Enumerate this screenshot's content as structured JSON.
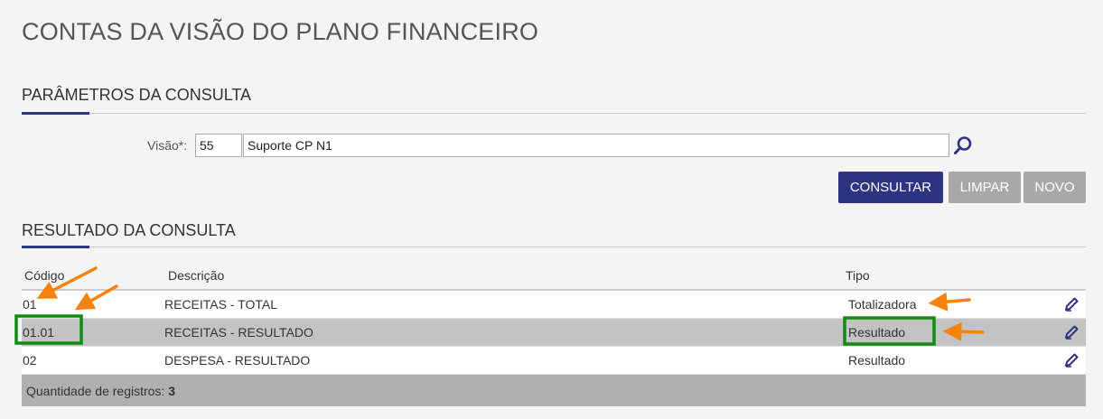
{
  "page": {
    "title": "CONTAS DA VISÃO DO PLANO FINANCEIRO"
  },
  "params": {
    "section_title": "PARÂMETROS DA CONSULTA",
    "visao_label": "Visão*:",
    "visao_code": "55",
    "visao_name": "Suporte CP N1",
    "search_icon": "magnifier-icon"
  },
  "buttons": {
    "consultar": "CONSULTAR",
    "limpar": "LIMPAR",
    "novo": "NOVO"
  },
  "results": {
    "section_title": "RESULTADO DA CONSULTA",
    "columns": {
      "codigo": "Código",
      "descricao": "Descrição",
      "tipo": "Tipo"
    },
    "rows": [
      {
        "codigo": "01",
        "descricao": "RECEITAS - TOTAL",
        "tipo": "Totalizadora",
        "selected": false
      },
      {
        "codigo": "01.01",
        "descricao": "RECEITAS - RESULTADO",
        "tipo": "Resultado",
        "selected": true
      },
      {
        "codigo": "02",
        "descricao": "DESPESA - RESULTADO",
        "tipo": "Resultado",
        "selected": false
      }
    ],
    "footer_label": "Quantidade de registros:",
    "footer_count": "3"
  },
  "colors": {
    "accent": "#2d3482",
    "disabled": "#a8a8a8",
    "selected_row": "#c3c3c3",
    "annotation_arrow": "#f5820d",
    "annotation_box": "#138a13"
  }
}
